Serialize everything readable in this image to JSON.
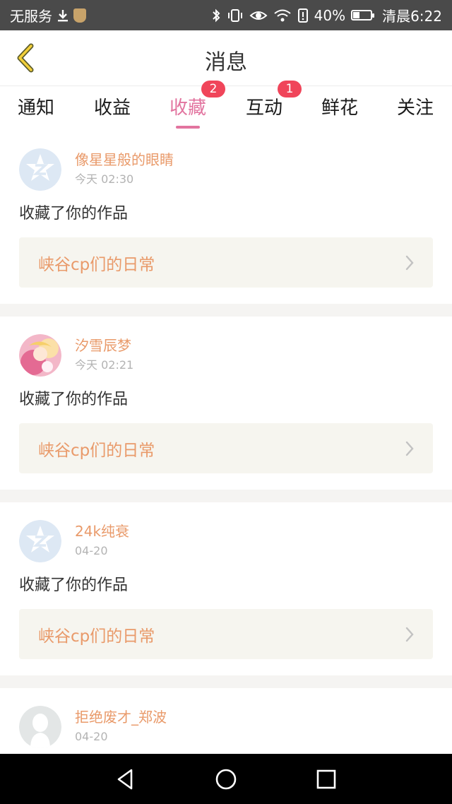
{
  "status_bar": {
    "carrier": "无服务",
    "download_icon": "download-icon",
    "shield_icon": "shield-icon",
    "battery_percent": "40%",
    "battery_level": 0.4,
    "time": "清晨6:22"
  },
  "header": {
    "title": "消息",
    "back_icon": "back-chevron-icon"
  },
  "tabs": [
    {
      "label": "通知",
      "badge": ""
    },
    {
      "label": "收益",
      "badge": ""
    },
    {
      "label": "收藏",
      "badge": "2",
      "active": true
    },
    {
      "label": "互动",
      "badge": "1"
    },
    {
      "label": "鲜花",
      "badge": ""
    },
    {
      "label": "关注",
      "badge": ""
    }
  ],
  "colors": {
    "accent": "#e2749f",
    "name": "#e99a6a",
    "badge": "#f0455a"
  },
  "items": [
    {
      "username": "像星星般的眼睛",
      "time": "今天 02:30",
      "action": "收藏了你的作品",
      "work_title": "峡谷cp们的日常",
      "avatar": "default-avatar-icon"
    },
    {
      "username": "汐雪辰梦",
      "time": "今天 02:21",
      "action": "收藏了你的作品",
      "work_title": "峡谷cp们的日常",
      "avatar": "photo-avatar"
    },
    {
      "username": "24k纯衰",
      "time": "04-20",
      "action": "收藏了你的作品",
      "work_title": "峡谷cp们的日常",
      "avatar": "default-avatar-icon"
    },
    {
      "username": "拒绝废才_郑波",
      "time": "04-20",
      "avatar": "silhouette-avatar"
    }
  ],
  "nav": {
    "back": "nav-back-icon",
    "home": "nav-home-icon",
    "recents": "nav-recents-icon"
  }
}
